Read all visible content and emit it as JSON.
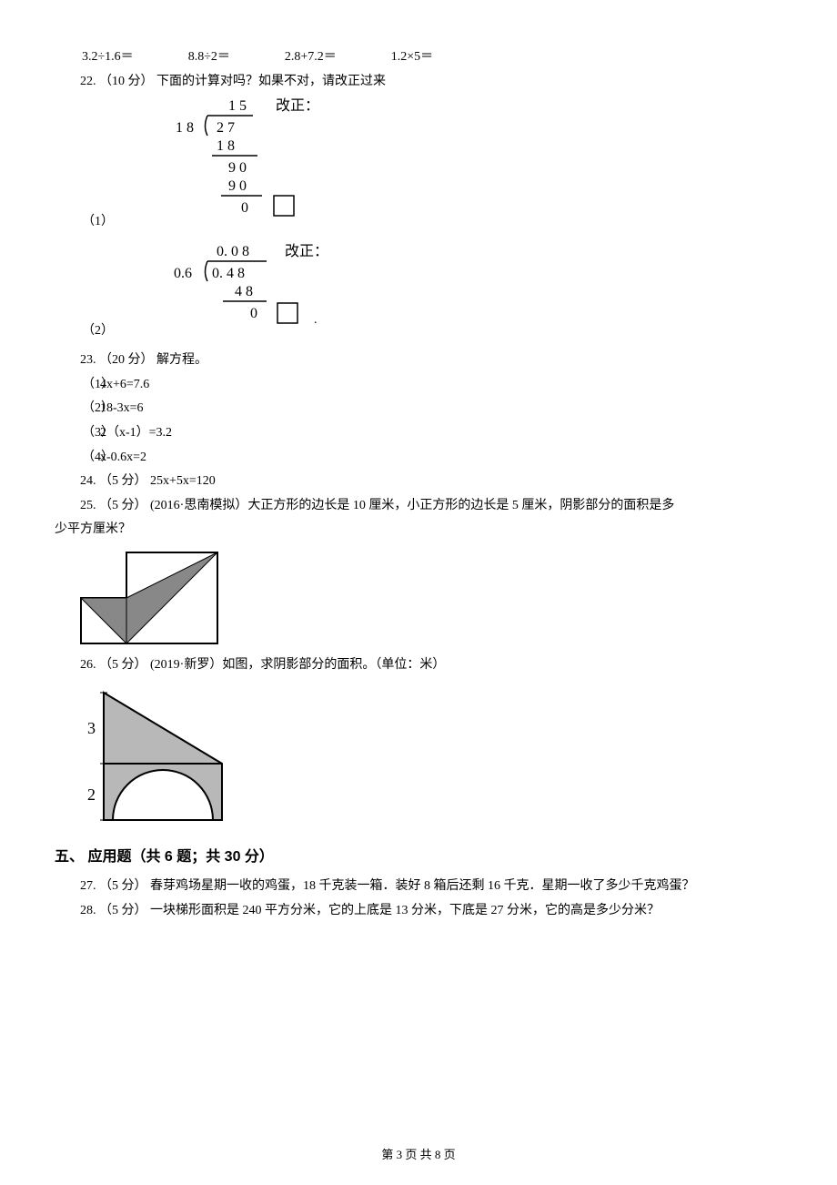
{
  "equations": {
    "a": "3.2÷1.6＝",
    "b": "8.8÷2＝",
    "c": "2.8+7.2＝",
    "d": "1.2×5＝"
  },
  "q22": {
    "line": "22.  （10 分）  下面的计算对吗？如果不对，请改正过来",
    "sub1_label": "（1）",
    "fig1_correct": "改正：",
    "sub2_label": "（2）",
    "fig2_correct": "改正：",
    "division1": {
      "divisor_row": "1 8",
      "quotient": "1 5",
      "dividend": "2 7",
      "step1": "1 8",
      "step2": "9 0",
      "step3": "9 0",
      "remainder": "0"
    },
    "division2": {
      "divisor_row": "0.6",
      "quotient": "0. 0 8",
      "dividend": "0. 4  8",
      "step1": "4 8",
      "remainder": "0"
    }
  },
  "q23": {
    "line": "23.  （20 分）  解方程。",
    "items": {
      "1": {
        "label": "（1）",
        "text": "4x+6=7.6"
      },
      "2": {
        "label": "（2）",
        "text": "18-3x=6"
      },
      "3": {
        "label": "（3）",
        "text": "2（x-1）=3.2"
      },
      "4": {
        "label": "（4）",
        "text": "x-0.6x=2"
      }
    }
  },
  "q24": "24.  （5 分）  25x+5x=120",
  "q25": {
    "line1": "25.  （5 分）  (2016·思南模拟）大正方形的边长是 10 厘米，小正方形的边长是 5 厘米，阴影部分的面积是多",
    "line2": "少平方厘米？"
  },
  "q26": {
    "line": "26.  （5 分）  (2019·新罗）如图，求阴影部分的面积。（单位：米）",
    "label_top": "3",
    "label_bottom": "2"
  },
  "section5": "五、  应用题（共 6 题；共 30 分）",
  "q27": "27.  （5 分）  春芽鸡场星期一收的鸡蛋，18 千克装一箱．装好 8 箱后还剩 16 千克．星期一收了多少千克鸡蛋？",
  "q28": "28.  （5 分）  一块梯形面积是 240 平方分米，它的上底是 13 分米，下底是 27 分米，它的高是多少分米？",
  "pager": "第 3 页 共 8 页"
}
